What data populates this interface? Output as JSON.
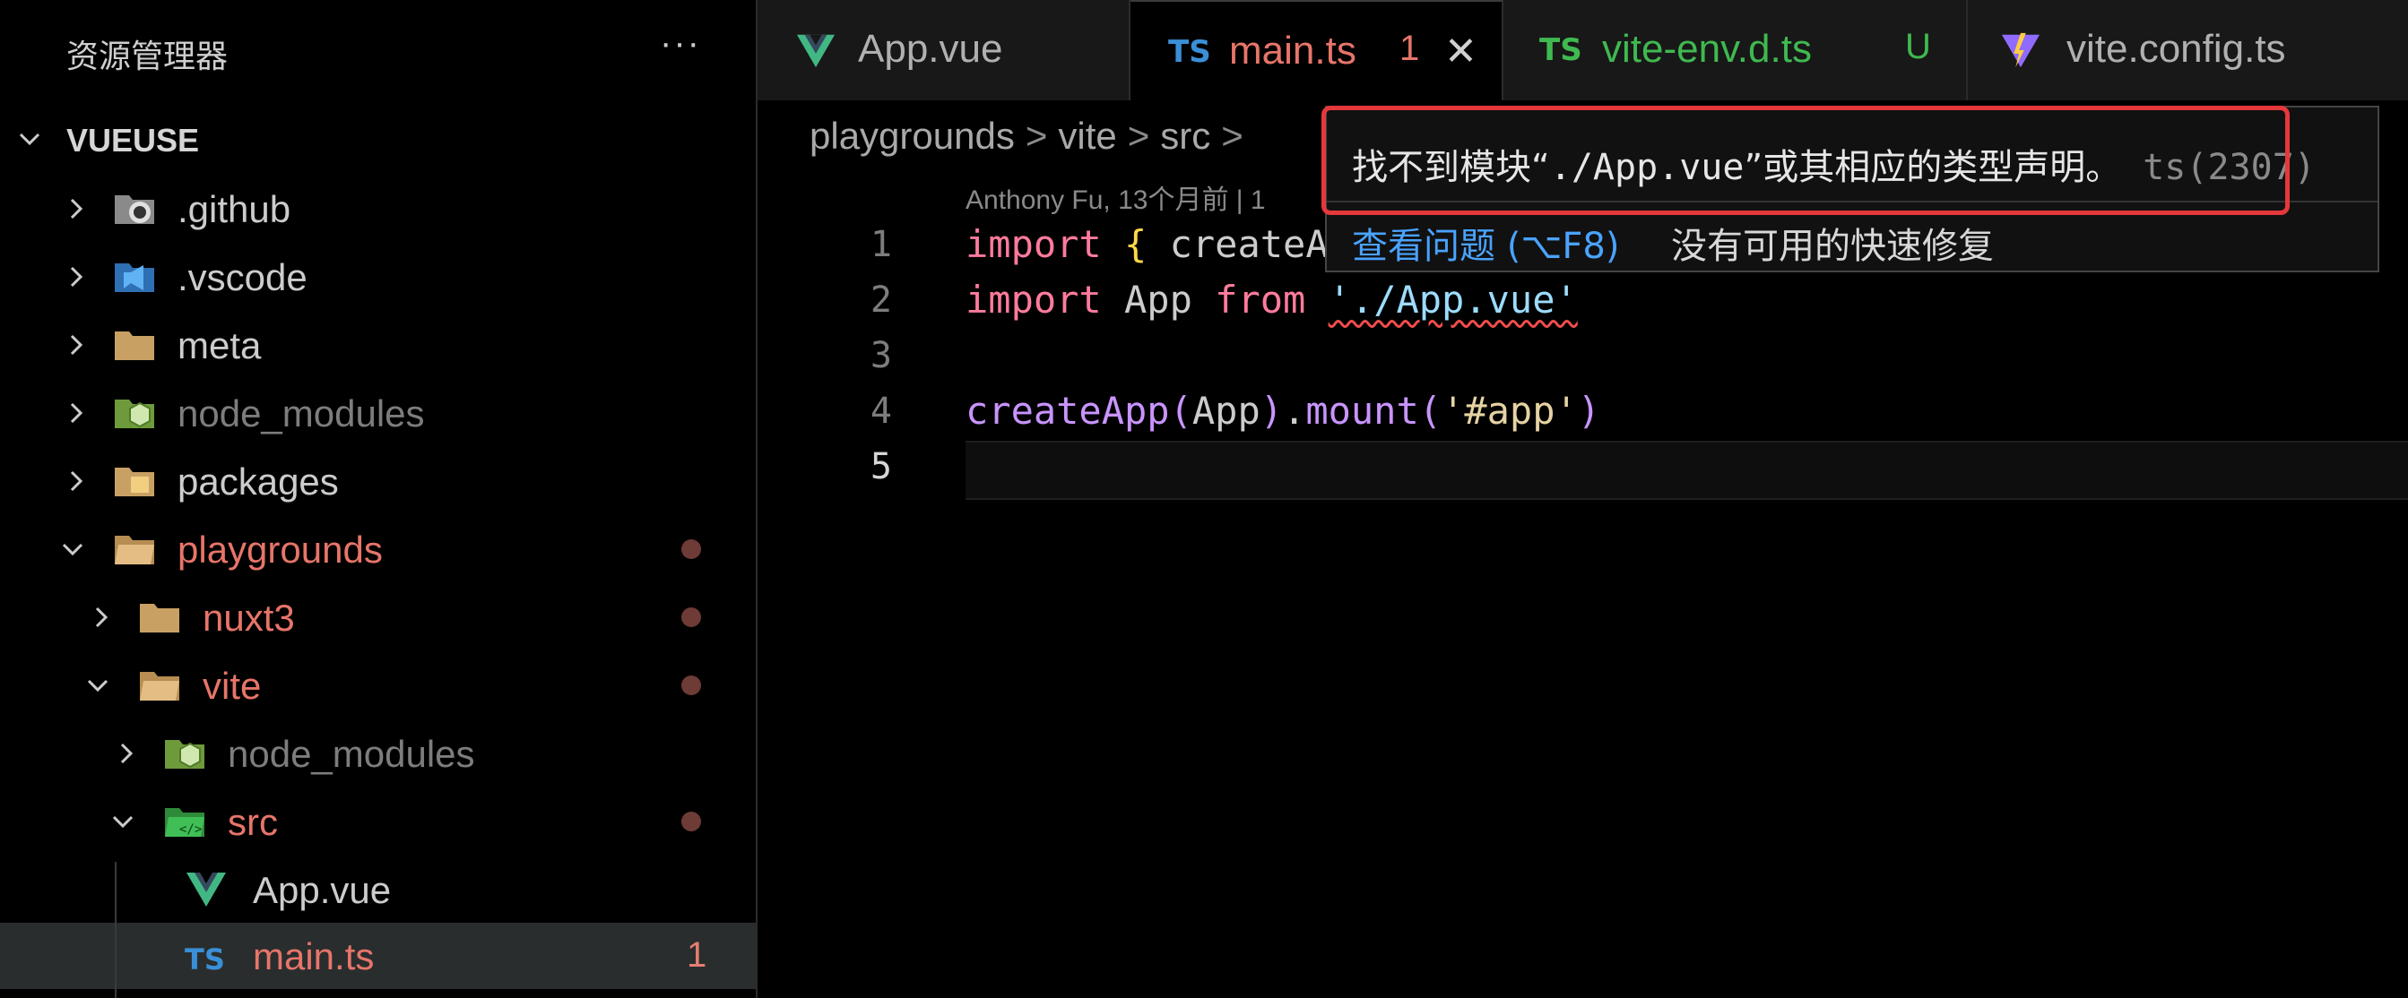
{
  "sidebar": {
    "title": "资源管理器",
    "more_label": "···",
    "section_label": "VUEUSE",
    "items": [
      {
        "name": ".github"
      },
      {
        "name": ".vscode"
      },
      {
        "name": "meta"
      },
      {
        "name": "node_modules"
      },
      {
        "name": "packages"
      },
      {
        "name": "playgrounds"
      },
      {
        "name": "nuxt3"
      },
      {
        "name": "vite"
      },
      {
        "name": "node_modules"
      },
      {
        "name": "src"
      },
      {
        "name": "App.vue"
      },
      {
        "name": "main.ts",
        "problems": "1"
      }
    ]
  },
  "tabs": [
    {
      "label": "App.vue"
    },
    {
      "label": "main.ts",
      "badge": "TS",
      "problems": "1",
      "close": "✕"
    },
    {
      "label": "vite-env.d.ts",
      "badge": "TS",
      "status": "U"
    },
    {
      "label": "vite.config.ts"
    }
  ],
  "breadcrumb": [
    "playgrounds",
    "vite",
    "src"
  ],
  "blame": "Anthony Fu, 13个月前 | 1",
  "editor": {
    "line_numbers": [
      "1",
      "2",
      "3",
      "4",
      "5"
    ],
    "line1": {
      "kw": "import",
      "open": "{",
      "ident": "createA"
    },
    "line2": {
      "kw": "import",
      "ident": "App",
      "from": "from",
      "str": "'./App.vue'"
    },
    "line4": {
      "fn": "createApp",
      "open": "(",
      "arg": "App",
      "close": ")",
      "dot": ".",
      "method": "mount",
      "open2": "(",
      "str": "'#app'",
      "close2": ")"
    }
  },
  "hover": {
    "message_pre": "找不到模块“",
    "message_code": "./App.vue",
    "message_post": "”或其相应的类型声明。",
    "code": "ts(2307)",
    "action": "查看问题 (⌥F8)",
    "no_fix": "没有可用的快速修复"
  },
  "colors": {
    "modified": "#e7756a",
    "untracked": "#3fb950",
    "accent": "#4aa3ff",
    "error": "#e5383b"
  }
}
